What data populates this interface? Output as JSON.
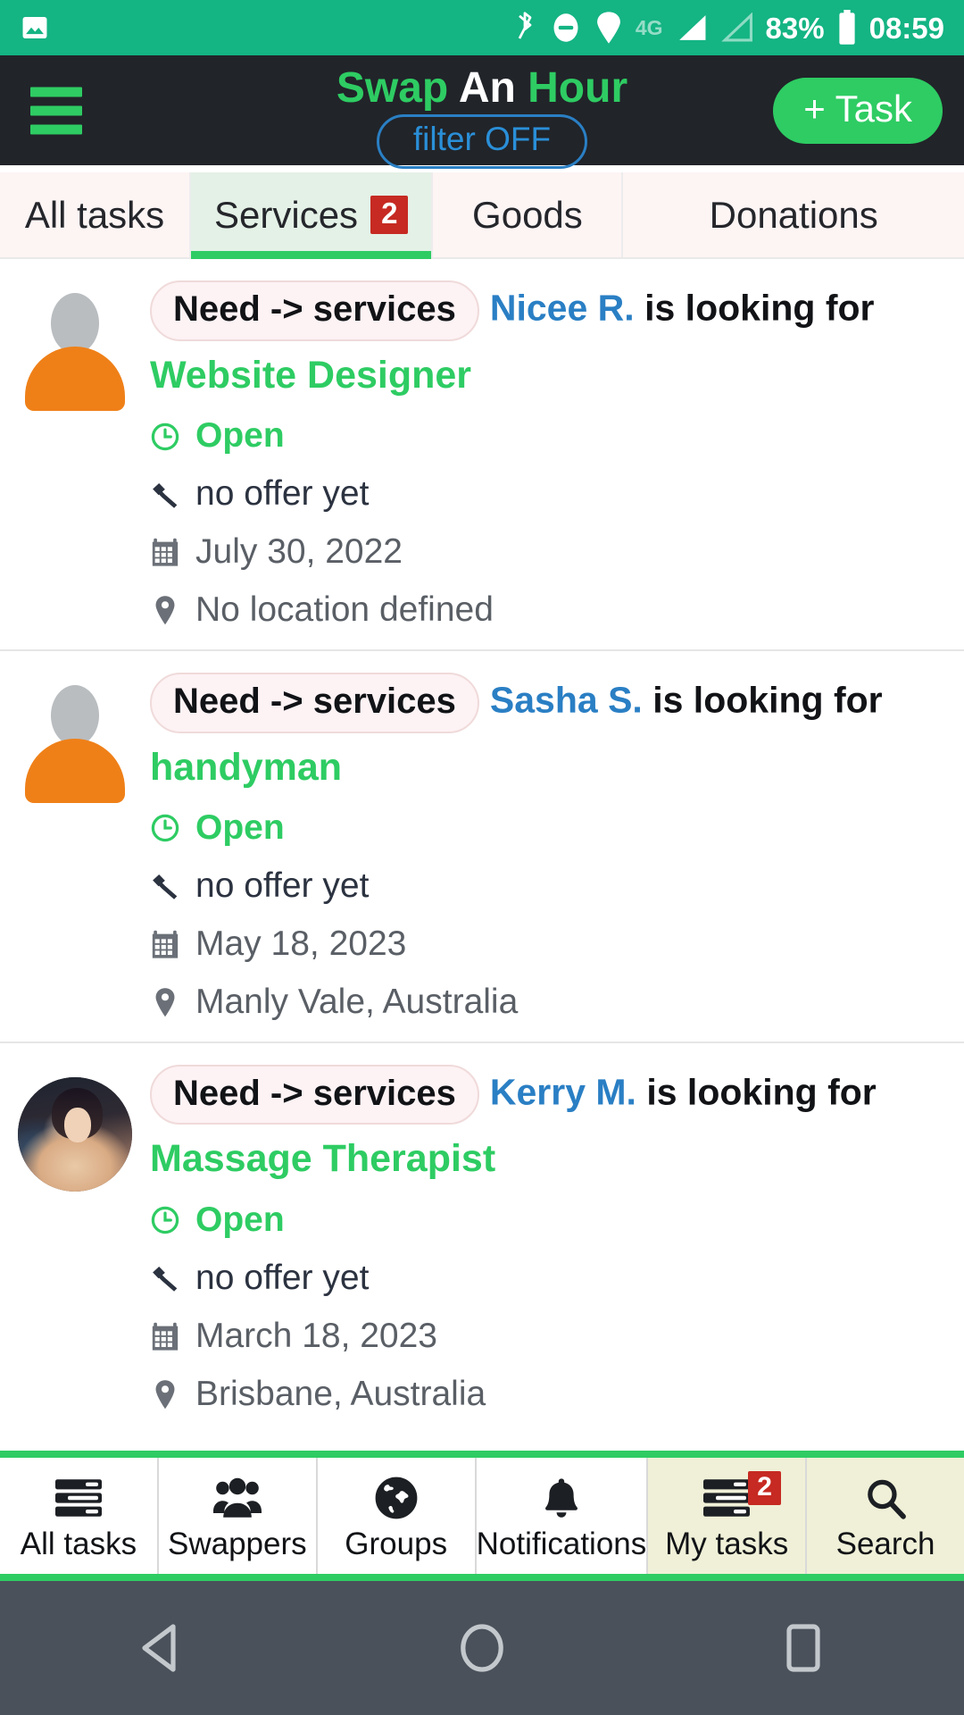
{
  "status_bar": {
    "background": "#14b483",
    "network": "4G",
    "battery_percent": "83%",
    "time": "08:59",
    "icons": [
      "image-icon",
      "bluetooth-icon",
      "do-not-disturb-icon",
      "location-icon",
      "signal-icon",
      "signal-empty-icon",
      "battery-icon"
    ]
  },
  "header": {
    "background": "#212429",
    "title_part1": "Swap",
    "title_part2": "An",
    "title_part3": "Hour",
    "title_accent": "#2ecc63",
    "filter_label": "filter OFF",
    "filter_color": "#2a8fd8",
    "add_task_label": "+ Task",
    "add_task_color": "#2ecc63",
    "menu_icon": "hamburger-menu-icon"
  },
  "tabs": [
    {
      "label": "All tasks",
      "badge": "",
      "active": false
    },
    {
      "label": "Services",
      "badge": "2",
      "active": true
    },
    {
      "label": "Goods",
      "badge": "",
      "active": false
    },
    {
      "label": "Donations",
      "badge": "",
      "active": false
    }
  ],
  "tab_styles": {
    "active_background": "#e4f1e6",
    "inactive_background": "#fdf4f4",
    "indicator_color": "#2ecc63",
    "badge_color": "#c62a22"
  },
  "tasks": [
    {
      "avatar": "default-silhouette-avatar",
      "pill": "Need -> services",
      "user": "Nicee R.",
      "phrase": "is looking for",
      "need_title": "Website Designer",
      "need_title_color": "#2ecc63",
      "status": "Open",
      "offer": "no offer yet",
      "date": "July 30, 2022",
      "location": "No location defined"
    },
    {
      "avatar": "default-silhouette-avatar",
      "pill": "Need -> services",
      "user": "Sasha S.",
      "phrase": "is looking for",
      "need_title": "handyman",
      "need_title_color": "#2ecc63",
      "status": "Open",
      "offer": "no offer yet",
      "date": "May 18, 2023",
      "location": "Manly Vale, Australia"
    },
    {
      "avatar": "photo-avatar",
      "pill": "Need -> services",
      "user": "Kerry M.",
      "phrase": "is looking for",
      "need_title": "Massage Therapist",
      "need_title_color": "#2ecc63",
      "status": "Open",
      "offer": "no offer yet",
      "date": "March 18, 2023",
      "location": "Brisbane, Australia"
    }
  ],
  "bottom_nav": {
    "border_color": "#2ecc63",
    "highlight_background": "#eff0d7",
    "items": [
      {
        "label": "All tasks",
        "icon": "task-list-icon",
        "badge": "",
        "highlighted": false
      },
      {
        "label": "Swappers",
        "icon": "people-group-icon",
        "badge": "",
        "highlighted": false
      },
      {
        "label": "Groups",
        "icon": "globe-icon",
        "badge": "",
        "highlighted": false
      },
      {
        "label": "Notifications",
        "icon": "bell-icon",
        "badge": "",
        "highlighted": false
      },
      {
        "label": "My tasks",
        "icon": "task-list-icon",
        "badge": "2",
        "highlighted": true
      },
      {
        "label": "Search",
        "icon": "search-icon",
        "badge": "",
        "highlighted": true
      }
    ]
  },
  "android_nav": {
    "background": "#4a515a",
    "buttons": [
      "back-triangle-icon",
      "home-circle-icon",
      "recents-square-icon"
    ]
  }
}
